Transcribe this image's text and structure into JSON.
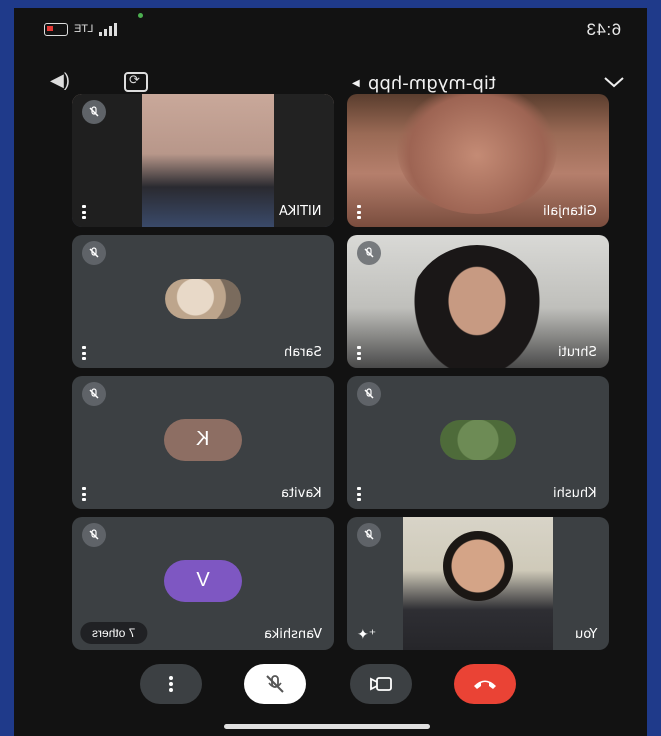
{
  "status": {
    "time": "6:43",
    "network": "LTE"
  },
  "header": {
    "meeting_code": "tip-mygm-hpp"
  },
  "tiles": [
    {
      "name": "NITIKA"
    },
    {
      "name": "Gitanjali"
    },
    {
      "name": "Sarah"
    },
    {
      "name": "Shruti"
    },
    {
      "name": "Kavita",
      "letter": "K",
      "avatar_color": "#8d6e63"
    },
    {
      "name": "Khushi"
    },
    {
      "name": "Vanshika",
      "letter": "V",
      "avatar_color": "#7e57c2",
      "others_label": "7 others"
    },
    {
      "name": "You"
    }
  ],
  "colors": {
    "end_call": "#ea4335",
    "tile_bg": "#3c4043",
    "frame_border": "#1f3a8a"
  },
  "icons": {
    "more": "more-vertical-icon",
    "mic": "mic-off-icon",
    "camera": "camera-icon",
    "end": "end-call-icon"
  }
}
